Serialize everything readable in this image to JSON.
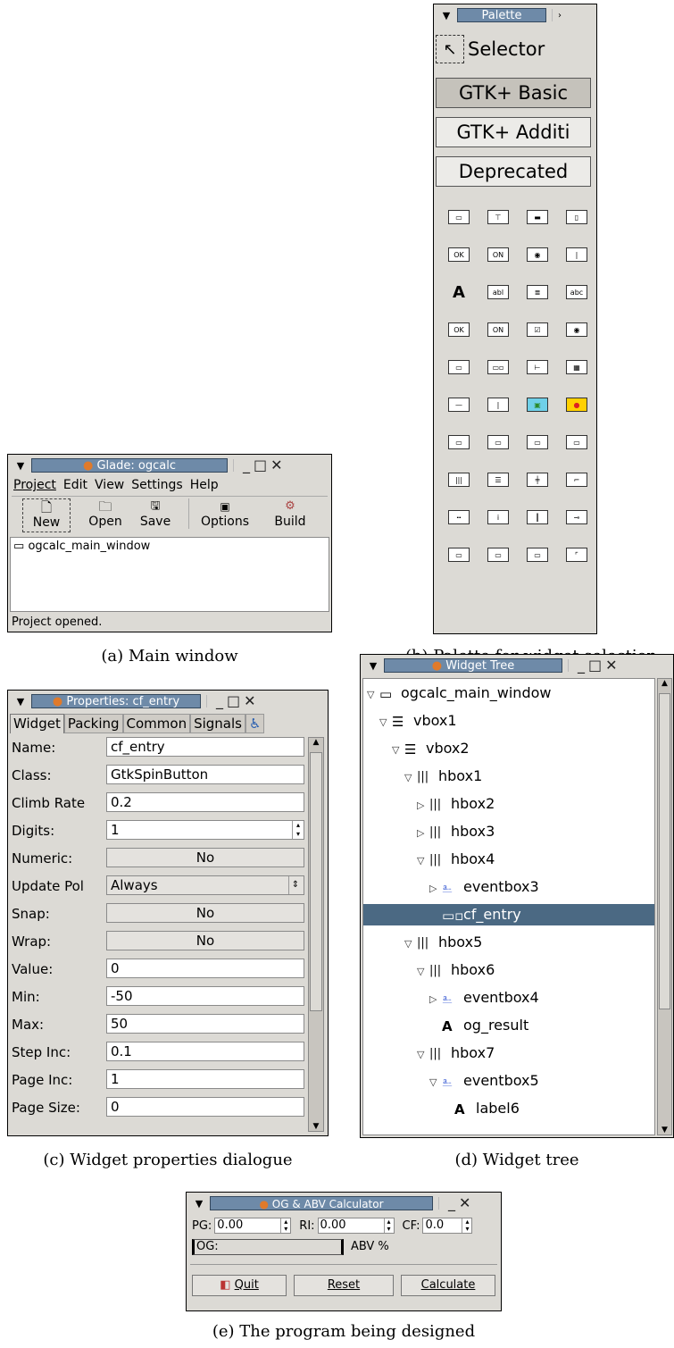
{
  "main_window": {
    "title": "Glade: ogcalc",
    "menu": [
      "Project",
      "Edit",
      "View",
      "Settings",
      "Help"
    ],
    "toolbar": [
      "New",
      "Open",
      "Save",
      "Options",
      "Build"
    ],
    "tree_item": "ogcalc_main_window",
    "status": "Project opened.",
    "caption": "(a) Main window"
  },
  "palette": {
    "title": "Palette",
    "selector": "Selector",
    "groups": [
      "GTK+ Basic",
      "GTK+ Additi",
      "Deprecated"
    ],
    "caption": "(b) Palette for widget selection"
  },
  "properties": {
    "title": "Properties: cf_entry",
    "tabs": [
      "Widget",
      "Packing",
      "Common",
      "Signals"
    ],
    "rows": [
      {
        "label": "Name:",
        "value": "cf_entry",
        "kind": "text"
      },
      {
        "label": "Class:",
        "value": "GtkSpinButton",
        "kind": "text"
      },
      {
        "label": "Climb Rate",
        "value": "0.2",
        "kind": "text"
      },
      {
        "label": "Digits:",
        "value": "1",
        "kind": "spin"
      },
      {
        "label": "Numeric:",
        "value": "No",
        "kind": "button"
      },
      {
        "label": "Update Pol",
        "value": "Always",
        "kind": "combo"
      },
      {
        "label": "Snap:",
        "value": "No",
        "kind": "button"
      },
      {
        "label": "Wrap:",
        "value": "No",
        "kind": "button"
      },
      {
        "label": "Value:",
        "value": "0",
        "kind": "text"
      },
      {
        "label": "Min:",
        "value": "-50",
        "kind": "text"
      },
      {
        "label": "Max:",
        "value": "50",
        "kind": "text"
      },
      {
        "label": "Step Inc:",
        "value": "0.1",
        "kind": "text"
      },
      {
        "label": "Page Inc:",
        "value": "1",
        "kind": "text"
      },
      {
        "label": "Page Size:",
        "value": "0",
        "kind": "text"
      }
    ],
    "caption": "(c) Widget properties dialogue"
  },
  "tree": {
    "title": "Widget Tree",
    "items": [
      {
        "label": "ogcalc_main_window",
        "depth": 0,
        "toggle": "open",
        "icon": "window"
      },
      {
        "label": "vbox1",
        "depth": 1,
        "toggle": "open",
        "icon": "vbox"
      },
      {
        "label": "vbox2",
        "depth": 2,
        "toggle": "open",
        "icon": "vbox"
      },
      {
        "label": "hbox1",
        "depth": 3,
        "toggle": "open",
        "icon": "hbox"
      },
      {
        "label": "hbox2",
        "depth": 4,
        "toggle": "closed",
        "icon": "hbox"
      },
      {
        "label": "hbox3",
        "depth": 4,
        "toggle": "closed",
        "icon": "hbox"
      },
      {
        "label": "hbox4",
        "depth": 4,
        "toggle": "open",
        "icon": "hbox"
      },
      {
        "label": "eventbox3",
        "depth": 5,
        "toggle": "closed",
        "icon": "eventbox"
      },
      {
        "label": "cf_entry",
        "depth": 5,
        "toggle": "none",
        "icon": "spin",
        "selected": true
      },
      {
        "label": "hbox5",
        "depth": 3,
        "toggle": "open",
        "icon": "hbox"
      },
      {
        "label": "hbox6",
        "depth": 4,
        "toggle": "open",
        "icon": "hbox"
      },
      {
        "label": "eventbox4",
        "depth": 5,
        "toggle": "closed",
        "icon": "eventbox"
      },
      {
        "label": "og_result",
        "depth": 5,
        "toggle": "none",
        "icon": "label"
      },
      {
        "label": "hbox7",
        "depth": 4,
        "toggle": "open",
        "icon": "hbox"
      },
      {
        "label": "eventbox5",
        "depth": 5,
        "toggle": "open",
        "icon": "eventbox"
      },
      {
        "label": "label6",
        "depth": 6,
        "toggle": "none",
        "icon": "label"
      }
    ],
    "caption": "(d) Widget tree"
  },
  "calculator": {
    "title": "OG & ABV Calculator",
    "pg_label": "PG:",
    "pg_value": "0.00",
    "ri_label": "RI:",
    "ri_value": "0.00",
    "cf_label": "CF:",
    "cf_value": "0.0",
    "og_label": "OG:",
    "abv_label": "ABV %",
    "buttons": [
      "Quit",
      "Reset",
      "Calculate"
    ],
    "caption": "(e) The program being designed"
  },
  "colors": {
    "selection": "#4b6983",
    "title_bg": "#6e8aa8",
    "window_bg": "#dcdad5"
  }
}
